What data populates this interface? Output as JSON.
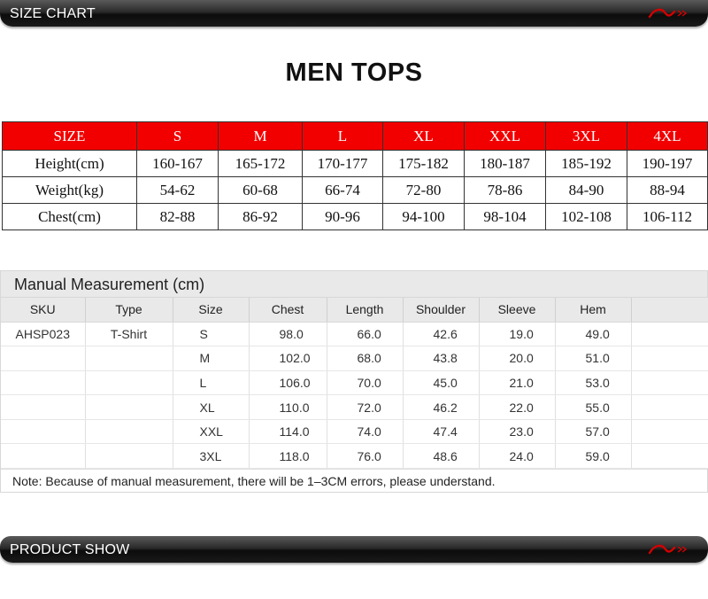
{
  "header": {
    "label": "SIZE CHART",
    "logo_icon": "li-ning-logo-icon",
    "accent_color": "#d40000"
  },
  "title": "MEN TOPS",
  "size_chart": {
    "header_color": "#f20000",
    "columns": [
      "SIZE",
      "S",
      "M",
      "L",
      "XL",
      "XXL",
      "3XL",
      "4XL"
    ],
    "rows": [
      [
        "Height(cm)",
        "160-167",
        "165-172",
        "170-177",
        "175-182",
        "180-187",
        "185-192",
        "190-197"
      ],
      [
        "Weight(kg)",
        "54-62",
        "60-68",
        "66-74",
        "72-80",
        "78-86",
        "84-90",
        "88-94"
      ],
      [
        "Chest(cm)",
        "82-88",
        "86-92",
        "90-96",
        "94-100",
        "98-104",
        "102-108",
        "106-112"
      ]
    ]
  },
  "manual": {
    "title": "Manual Measurement (cm)",
    "columns": [
      "SKU",
      "Type",
      "Size",
      "Chest",
      "Length",
      "Shoulder",
      "Sleeve",
      "Hem",
      ""
    ],
    "rows": [
      [
        "AHSP023",
        "T-Shirt",
        "S",
        "98.0",
        "66.0",
        "42.6",
        "19.0",
        "49.0",
        ""
      ],
      [
        "",
        "",
        "M",
        "102.0",
        "68.0",
        "43.8",
        "20.0",
        "51.0",
        ""
      ],
      [
        "",
        "",
        "L",
        "106.0",
        "70.0",
        "45.0",
        "21.0",
        "53.0",
        ""
      ],
      [
        "",
        "",
        "XL",
        "110.0",
        "72.0",
        "46.2",
        "22.0",
        "55.0",
        ""
      ],
      [
        "",
        "",
        "XXL",
        "114.0",
        "74.0",
        "47.4",
        "23.0",
        "57.0",
        ""
      ],
      [
        "",
        "",
        "3XL",
        "118.0",
        "76.0",
        "48.6",
        "24.0",
        "59.0",
        ""
      ]
    ],
    "note": "Note: Because of manual measurement, there will be 1–3CM errors, please understand."
  },
  "footer": {
    "label": "PRODUCT SHOW",
    "logo_icon": "li-ning-logo-icon"
  }
}
